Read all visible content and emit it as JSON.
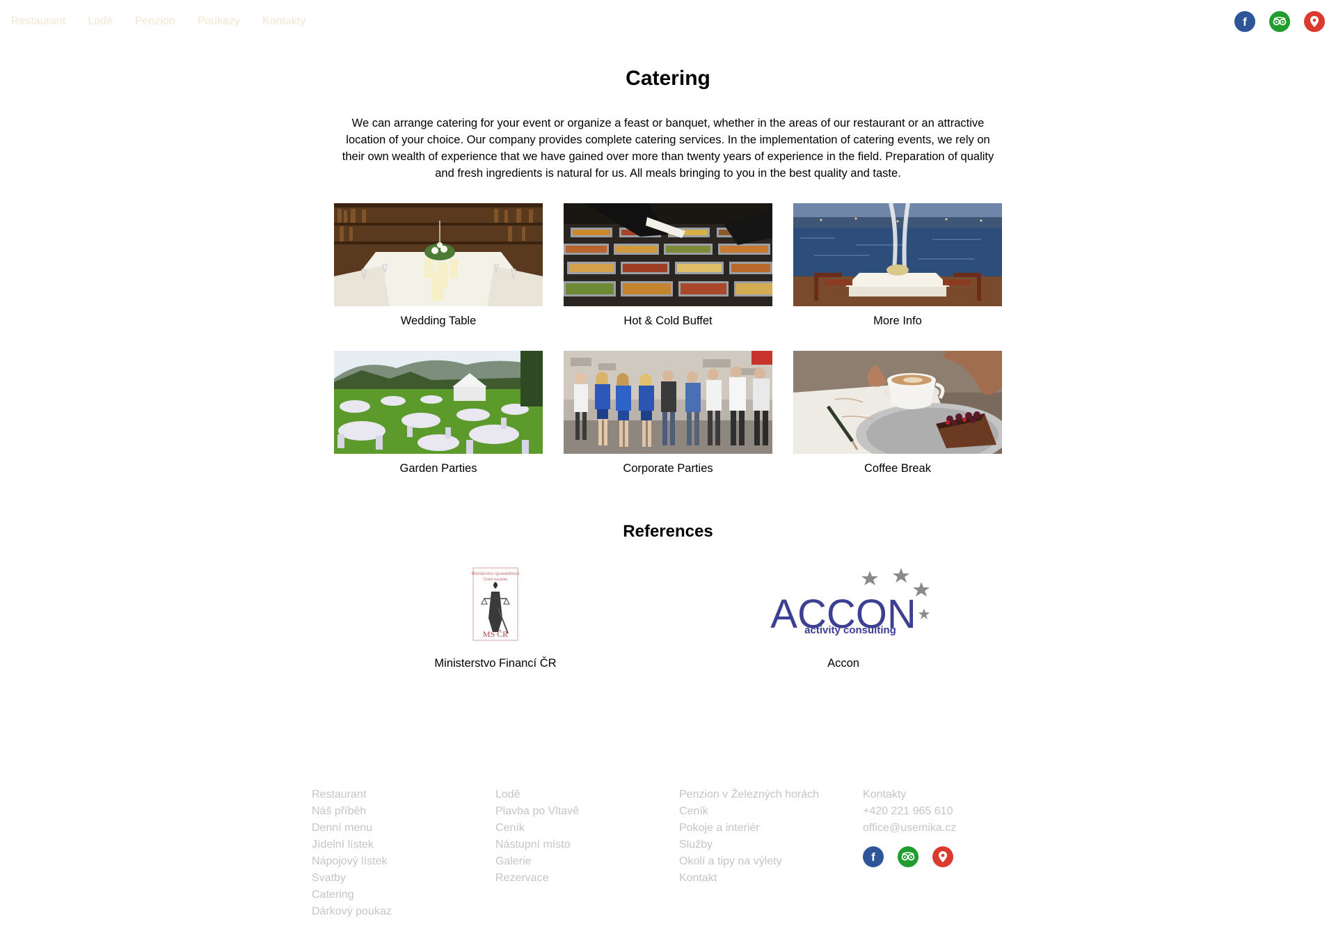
{
  "nav": {
    "items": [
      "Restaurant",
      "Lodě",
      "Penzion",
      "Poukazy",
      "Kontakty"
    ]
  },
  "social": {
    "facebook_icon": "facebook-icon",
    "tripadvisor_icon": "tripadvisor-icon",
    "map_icon": "map-pin-icon",
    "colors": {
      "facebook": "#2f5599",
      "tripadvisor": "#1f9e2f",
      "map": "#dc3a2e"
    }
  },
  "main": {
    "title": "Catering",
    "intro": "We can arrange catering for your event or organize a feast or banquet, whether in the areas of our restaurant or an attractive location of your choice. Our company provides complete catering services. In the implementation of catering events, we rely on their own wealth of experience that we have gained over more than twenty years of experience in the field. Preparation of quality and fresh ingredients is natural for us. All meals bringing to you in the best quality and taste.",
    "cards": [
      {
        "label": "Wedding Table"
      },
      {
        "label": "Hot & Cold Buffet"
      },
      {
        "label": "More Info"
      },
      {
        "label": "Garden Parties"
      },
      {
        "label": "Corporate Parties"
      },
      {
        "label": "Coffee Break"
      }
    ]
  },
  "references": {
    "title": "References",
    "items": [
      {
        "label": "Ministerstvo Financí ČR",
        "logo_text": "MS ČR"
      },
      {
        "label": "Accon",
        "logo_text": "ACCON",
        "logo_subtext": "activity consulting"
      }
    ]
  },
  "footer": {
    "columns": [
      [
        "Restaurant",
        "Náš příběh",
        "Denní menu",
        "Jídelní lístek",
        "Nápojový lístek",
        "Svatby",
        "Catering",
        "Dárkový poukaz"
      ],
      [
        "Lodě",
        "Plavba po Vltavě",
        "Ceník",
        "Nástupní místo",
        "Galerie",
        "Rezervace"
      ],
      [
        "Penzion v Železných horách",
        "Ceník",
        "Pokoje a interiér",
        "Služby",
        "Okolí a tipy na výlety",
        "Kontakt"
      ],
      [
        "Kontakty",
        "+420 221 965 610",
        "office@usemika.cz"
      ]
    ]
  }
}
